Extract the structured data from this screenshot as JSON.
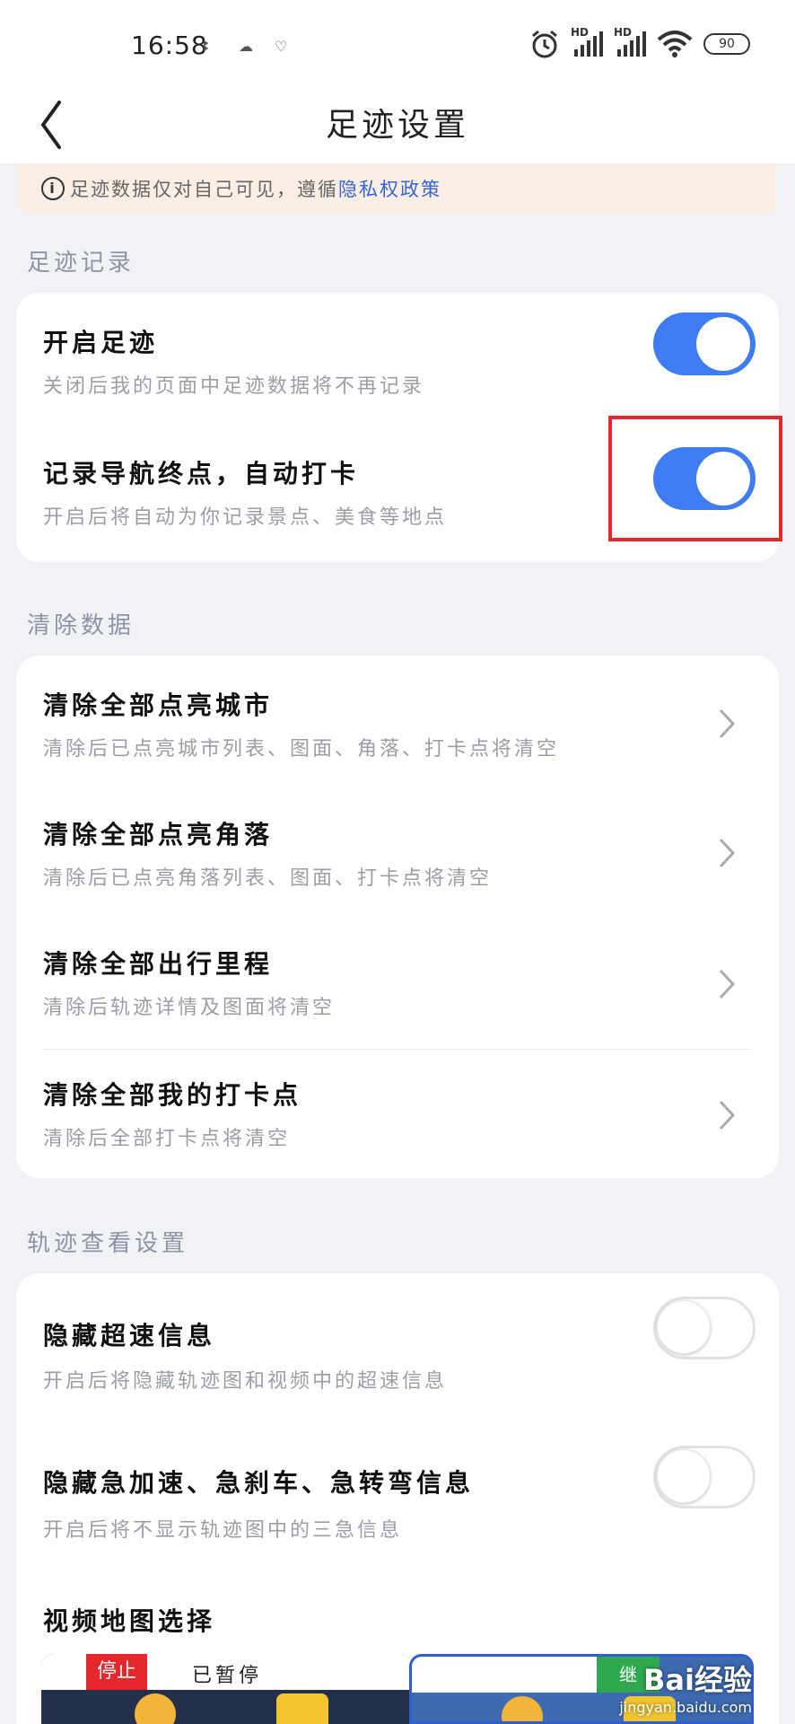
{
  "status_bar": {
    "time": "16:58",
    "notif_icons": [
      "ꔪ",
      "☁",
      "♡"
    ],
    "battery": "90",
    "hd1": "HD",
    "hd2": "HD"
  },
  "header": {
    "title": "足迹设置"
  },
  "notice": {
    "text": "足迹数据仅对自己可见，遵循",
    "link": "隐私权政策"
  },
  "sections": {
    "footprint_record": {
      "title": "足迹记录",
      "rows": [
        {
          "title": "开启足迹",
          "sub": "关闭后我的页面中足迹数据将不再记录",
          "toggle": "on"
        },
        {
          "title": "记录导航终点，自动打卡",
          "sub": "开启后将自动为你记录景点、美食等地点",
          "toggle": "on"
        }
      ]
    },
    "clear_data": {
      "title": "清除数据",
      "rows": [
        {
          "title": "清除全部点亮城市",
          "sub": "清除后已点亮城市列表、图面、角落、打卡点将清空"
        },
        {
          "title": "清除全部点亮角落",
          "sub": "清除后已点亮角落列表、图面、打卡点将清空"
        },
        {
          "title": "清除全部出行里程",
          "sub": "清除后轨迹详情及图面将清空"
        },
        {
          "title": "清除全部我的打卡点",
          "sub": "清除后全部打卡点将清空"
        }
      ]
    },
    "track_view": {
      "title": "轨迹查看设置",
      "rows": [
        {
          "title": "隐藏超速信息",
          "sub": "开启后将隐藏轨迹图和视频中的超速信息",
          "toggle": "off"
        },
        {
          "title": "隐藏急加速、急刹车、急转弯信息",
          "sub": "开启后将不显示轨迹图中的三急信息",
          "toggle": "off"
        }
      ],
      "video_map_title": "视频地图选择"
    }
  },
  "thumbnails": {
    "stop_label": "停止",
    "paused_label": "已暂停",
    "green_label": "继"
  },
  "watermark": {
    "main": "Bai经验",
    "sub": "jingyan.baidu.com"
  },
  "colors": {
    "accent": "#3e7cf4",
    "highlight": "#e5262b",
    "link": "#3466d6"
  }
}
